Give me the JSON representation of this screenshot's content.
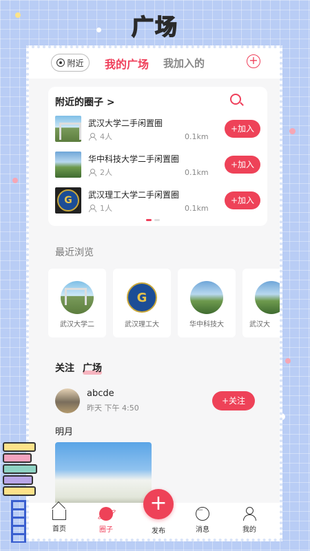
{
  "banner": {
    "title": "广场"
  },
  "topbar": {
    "nearby_label": "附近",
    "tab_mine": "我的广场",
    "tab_joined": "我加入的",
    "add_symbol": "+"
  },
  "nearby_card": {
    "title": "附近的圈子",
    "arrow": ">",
    "groups": [
      {
        "name": "武汉大学二手闲置圈",
        "members": "4人",
        "distance": "0.1km",
        "join": "+加入",
        "thumb": "gate"
      },
      {
        "name": "华中科技大学二手闲置圈",
        "members": "2人",
        "distance": "0.1km",
        "join": "+加入",
        "thumb": "campus"
      },
      {
        "name": "武汉理工大学二手闲置圈",
        "members": "1人",
        "distance": "0.1km",
        "join": "+加入",
        "thumb": "seal"
      }
    ]
  },
  "recent": {
    "title": "最近浏览",
    "items": [
      {
        "label": "武汉大学二",
        "thumb": "gate"
      },
      {
        "label": "武汉理工大",
        "thumb": "seal"
      },
      {
        "label": "华中科技大",
        "thumb": "campus"
      },
      {
        "label": "武汉大",
        "thumb": "campus"
      }
    ]
  },
  "feed": {
    "tab_follow": "关注",
    "tab_plaza": "广场",
    "post": {
      "user": "abcde",
      "time": "昨天 下午 4:50",
      "follow": "+关注",
      "text": "明月"
    }
  },
  "tabbar": {
    "home": "首页",
    "circle": "圈子",
    "publish": "发布",
    "publish_symbol": "+",
    "messages": "消息",
    "me": "我的"
  },
  "colors": {
    "accent": "#ee4258",
    "background": "#b9cdf5"
  }
}
